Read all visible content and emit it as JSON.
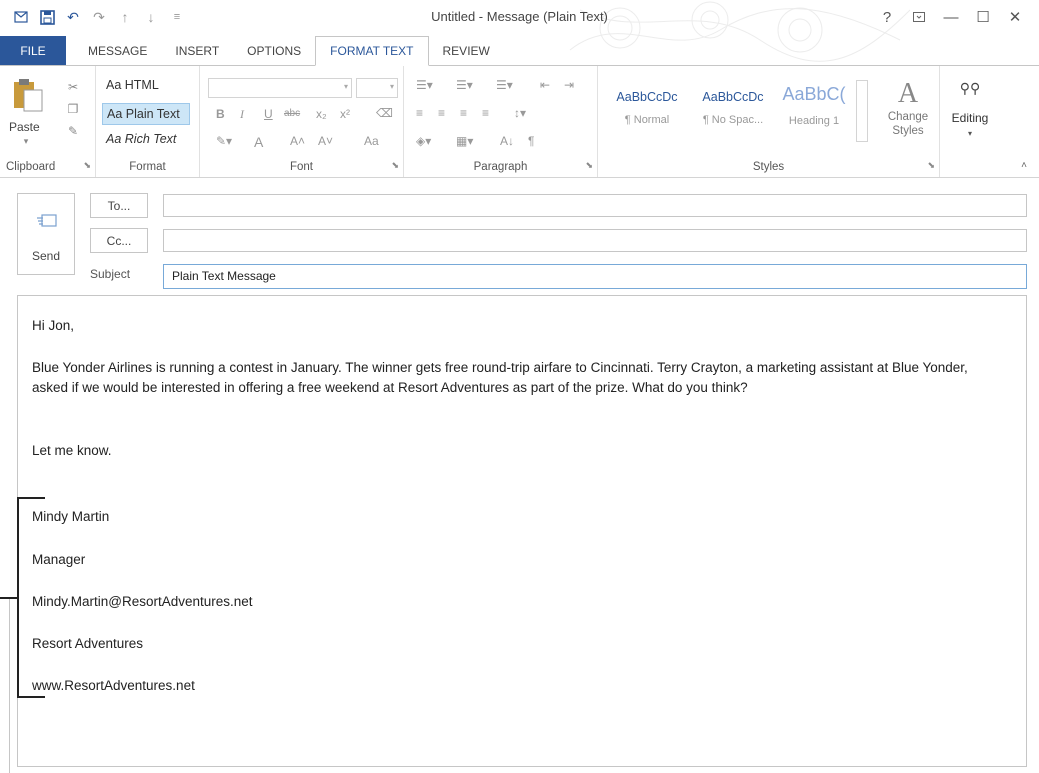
{
  "window": {
    "title": "Untitled - Message (Plain Text)",
    "help": "?",
    "controls": [
      "—",
      "☐",
      "✕"
    ]
  },
  "tabs": [
    "FILE",
    "MESSAGE",
    "INSERT",
    "OPTIONS",
    "FORMAT TEXT",
    "REVIEW"
  ],
  "active_tab": "FORMAT TEXT",
  "ribbon": {
    "clipboard": {
      "paste": "Paste",
      "label": "Clipboard"
    },
    "format": {
      "items": [
        "Aa HTML",
        "Aa Plain Text",
        "Aa Rich Text"
      ],
      "selected": "Aa Plain Text",
      "label": "Format"
    },
    "font": {
      "bold": "B",
      "italic": "I",
      "underline": "U",
      "strike": "abc",
      "sub": "x₂",
      "sup": "x²",
      "color": "A",
      "grow": "A˄",
      "shrink": "A˅",
      "case": "Aa",
      "label": "Font"
    },
    "paragraph": {
      "sort": "A↓",
      "pilcrow": "¶",
      "label": "Paragraph"
    },
    "styles": {
      "items": [
        {
          "sample": "AaBbCcDc",
          "name": "¶ Normal"
        },
        {
          "sample": "AaBbCcDc",
          "name": "¶ No Spac..."
        },
        {
          "sample": "AaBbC(",
          "name": "Heading 1"
        }
      ],
      "change": "Change Styles",
      "label": "Styles"
    },
    "editing": {
      "label": "Editing"
    }
  },
  "compose": {
    "send": "Send",
    "to_button": "To...",
    "cc_button": "Cc...",
    "to_value": "",
    "cc_value": "",
    "subject_label": "Subject",
    "subject_value": "Plain Text Message"
  },
  "message": {
    "greeting": "Hi Jon,",
    "paragraph": "Blue Yonder Airlines is running a contest in January. The winner gets free round-trip airfare to Cincinnati. Terry Crayton, a marketing assistant at Blue Yonder, asked if we would be interested in offering a free weekend at Resort Adventures as part of the prize. What do you think?",
    "closing": "Let me know.",
    "signature": [
      "Mindy Martin",
      "Manager",
      "Mindy.Martin@ResortAdventures.net",
      "Resort Adventures",
      "www.ResortAdventures.net"
    ]
  },
  "colors": {
    "accent": "#2b579a",
    "selected_bg": "#cde6f7"
  }
}
